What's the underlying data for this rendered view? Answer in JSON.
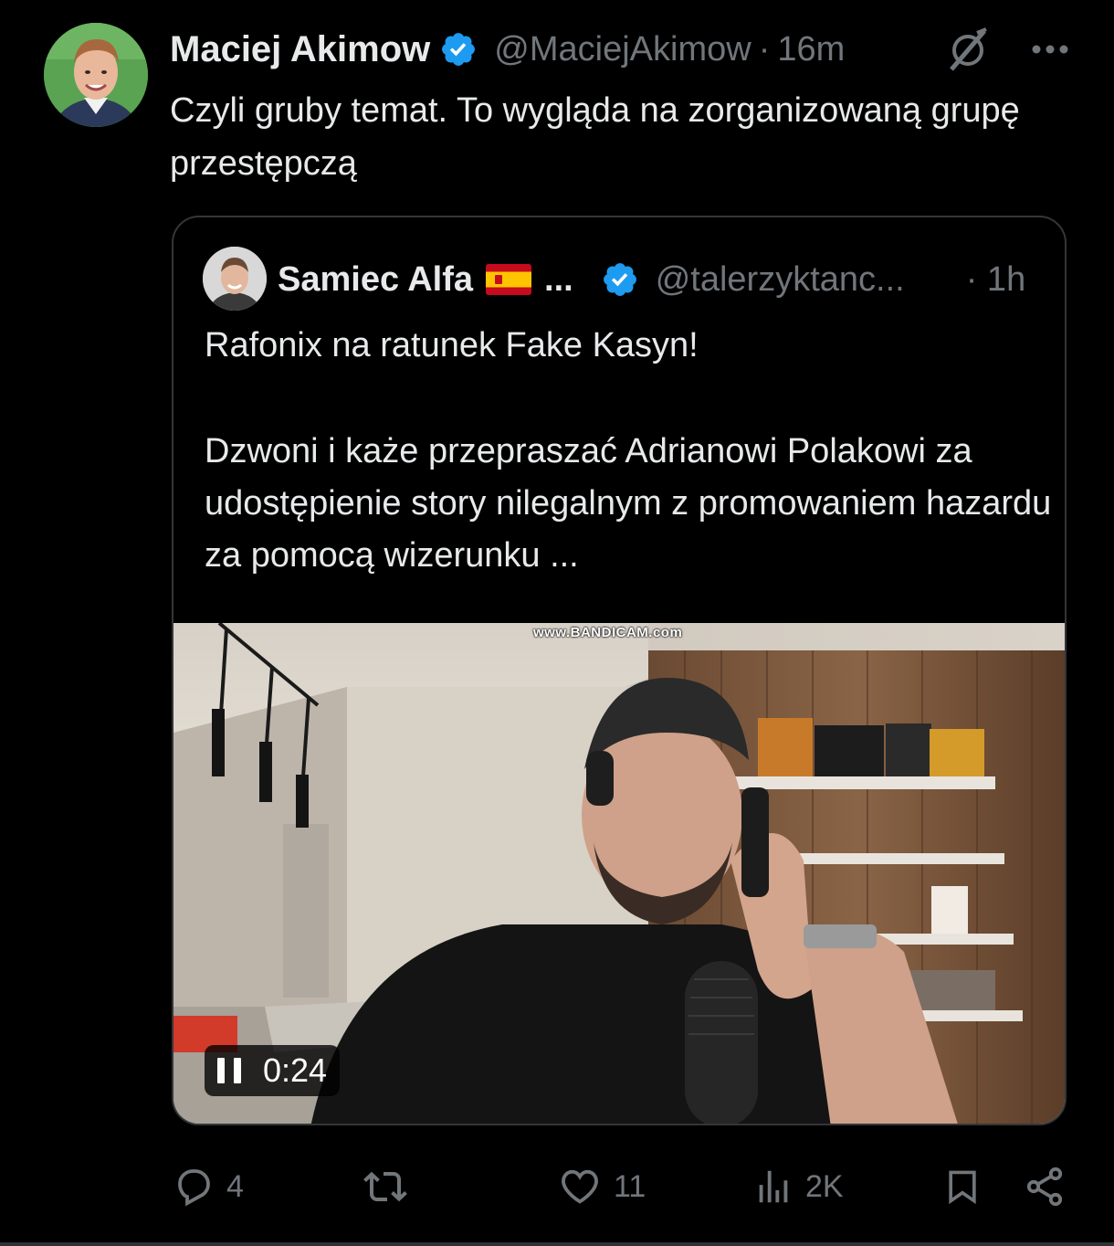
{
  "tweet": {
    "author_name": "Maciej Akimow",
    "handle": "@MaciejAkimow",
    "separator": "·",
    "time": "16m",
    "text": "Czyli gruby temat. To wygląda na zorganizowaną grupę przestępczą"
  },
  "quote": {
    "author_name": "Samiec Alfa",
    "flag": "spain-flag-emoji",
    "name_ellipsis": "...",
    "handle": "@talerzyktanc...",
    "time": "· 1h",
    "line1": "Rafonix na ratunek Fake Kasyn!",
    "line2": "Dzwoni i każe przepraszać Adrianowi Polakowi za udostępienie story nilegalnym z promowaniem hazardu za pomocą wizerunku ...",
    "video": {
      "watermark": "www.BANDICAM.com",
      "elapsed": "0:24",
      "state": "playing"
    }
  },
  "actions": {
    "replies": "4",
    "retweets": "",
    "likes": "11",
    "views": "2K"
  },
  "colors": {
    "background": "#000000",
    "text": "#e7e9ea",
    "muted": "#71767b",
    "verified": "#1d9bf0",
    "border": "#333639"
  }
}
